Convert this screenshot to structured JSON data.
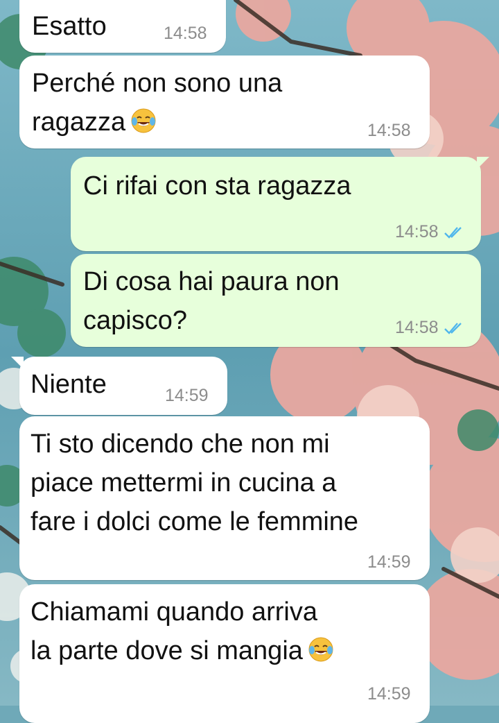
{
  "chat": {
    "messages": [
      {
        "direction": "in",
        "text": "Esatto",
        "time": "14:58",
        "emoji": ""
      },
      {
        "direction": "in",
        "text": "Perché non sono una\nragazza",
        "time": "14:58",
        "emoji": "face-with-tears-of-joy-icon"
      },
      {
        "direction": "out",
        "text": "Ci rifai con sta ragazza",
        "time": "14:58",
        "status": "read"
      },
      {
        "direction": "out",
        "text": "Di cosa hai paura non\ncapisco?",
        "time": "14:58",
        "status": "read"
      },
      {
        "direction": "in",
        "text": "Niente",
        "time": "14:59",
        "emoji": ""
      },
      {
        "direction": "in",
        "text": "Ti sto dicendo che non mi\npiace mettermi in cucina a\nfare i dolci come le femmine",
        "time": "14:59",
        "emoji": ""
      },
      {
        "direction": "in",
        "text": "Chiamami quando arriva\nla parte dove si mangia",
        "time": "14:59",
        "emoji": "face-with-tears-of-joy-icon"
      }
    ]
  },
  "colors": {
    "incoming_bubble": "#ffffff",
    "outgoing_bubble": "#e7ffdb",
    "read_ticks": "#4fb6ec",
    "timestamp": "#8c8c8c"
  }
}
